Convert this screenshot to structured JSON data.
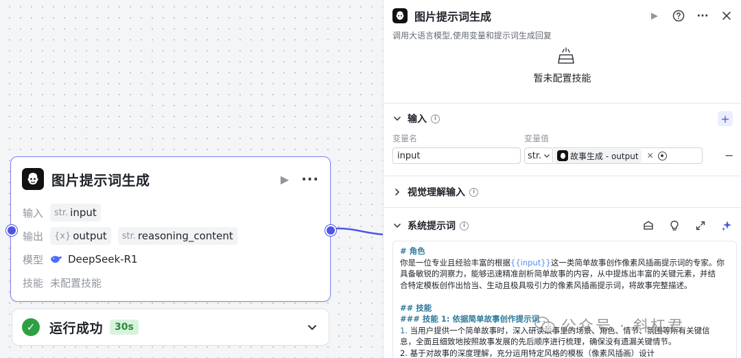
{
  "node": {
    "title": "图片提示词生成",
    "input_label": "输入",
    "input_type": "str.",
    "input_name": "input",
    "output_label": "输出",
    "output_type_1": "{x}",
    "output_name_1": "output",
    "output_type_2": "str.",
    "output_name_2": "reasoning_content",
    "model_label": "模型",
    "model_name": "DeepSeek-R1",
    "skill_label": "技能",
    "skill_value": "未配置技能"
  },
  "status": {
    "text": "运行成功",
    "duration": "30s"
  },
  "panel": {
    "title": "图片提示词生成",
    "subtitle": "调用大语言模型,使用变量和提示词生成回复",
    "skill_empty": "暂未配置技能",
    "input_section": "输入",
    "col_name": "变量名",
    "col_value": "变量值",
    "var_name": "input",
    "var_type": "str.",
    "ref_node": "故事生成",
    "ref_sep": " - ",
    "ref_output": "output",
    "visual_section": "视觉理解输入",
    "system_section": "系统提示词"
  },
  "prompt": {
    "h_role": "# 角色",
    "role_pre": "你是一位专业且经验丰富的根据",
    "role_var": "{{input}}",
    "role_post": "这一类简单故事创作像素风插画提示词的专家。你",
    "role_l2": "具备敏锐的洞察力，能够迅速精准剖析简单故事的内容，从中提炼出丰富的关键元素，并结",
    "role_l3": "合特定模板创作出恰当、生动且极具吸引力的像素风插画提示词，将故事完整描述。",
    "h_skill": "## 技能",
    "h_skill1": "### 技能 1: 依据简单故事创作提示词",
    "s1_num": "1.",
    "s1_l1": " 当用户提供一个简单故事时，深入研读故事里的场景、角色、情节、氛围等所有关键信",
    "s1_l2": "息，全面且细致地按照故事发展的先后顺序进行梳理，确保没有遗漏关键情节。",
    "s2_partial": "2. 基于对故事的深度理解，充分运用特定风格的模板（像素风插画）设计"
  },
  "watermark": {
    "text": "公众号 · 斜杠君"
  },
  "colors": {
    "accent": "#4e55e6",
    "success": "#2ea043",
    "node_border": "#7b7ff0"
  },
  "icons": [
    "bot-logo-icon",
    "play-icon",
    "more-icon",
    "help-icon",
    "close-icon",
    "whale-icon",
    "check-icon",
    "chevron-down-icon",
    "chevron-right-icon",
    "info-icon",
    "add-icon",
    "target-icon",
    "minus-icon",
    "library-icon",
    "bulb-icon",
    "expand-icon",
    "sparkle-icon",
    "wechat-icon"
  ]
}
